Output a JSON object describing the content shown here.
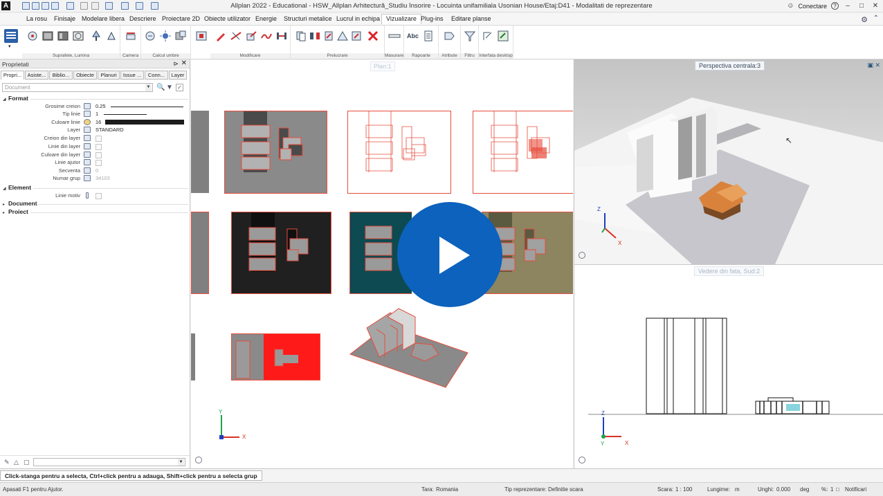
{
  "window": {
    "title": "Allplan 2022 - Educational - HSW_Allplan Arhitectură_Studiu însorire - Locuinta unifamiliala Usonian House/Etaj:D41 - Modalitati de reprezentare",
    "connect_label": "Conectare",
    "help_symbol": "?"
  },
  "menu": {
    "tabs": [
      "La rosu",
      "Finisaje",
      "Modelare libera",
      "Descriere",
      "Proiectare 2D",
      "Obiecte utilizator",
      "Energie",
      "Structuri metalice",
      "Lucrul in echipa",
      "Vizualizare",
      "Plug-ins",
      "Editare planse"
    ],
    "active": "Vizualizare"
  },
  "ribbon": {
    "groups": [
      "Suprafete, Lumina",
      "Camera",
      "Calcul umbre",
      "Modificare",
      "Prelucrare",
      "Masurare",
      "Rapoarte",
      "Atribute",
      "Filtru",
      "Interfata desktop"
    ],
    "icons": [
      "properties-icon",
      "surface-icon",
      "render-icon",
      "material-icon",
      "light-icon",
      "sun-icon",
      "camera-icon",
      "camera-path-icon",
      "shadow-icon",
      "sun-study-icon",
      "shadow-calc-icon",
      "edit-icon",
      "trim-icon",
      "move-icon",
      "stretch-icon",
      "split-icon",
      "copy-icon",
      "mirror-icon",
      "rotate-icon",
      "scale-icon",
      "measure-icon",
      "delete-icon",
      "dimension-icon",
      "text-icon",
      "report-icon",
      "attribute-icon",
      "filter-icon",
      "desktop-icon",
      "window-icon"
    ],
    "text_icon_label": "Abc"
  },
  "palette": {
    "title": "Proprietati",
    "tabs": [
      "Propri...",
      "Asiste...",
      "Biblio...",
      "Obiecte",
      "Planuri",
      "Issue ...",
      "Conn...",
      "Layer"
    ],
    "active_tab": "Propri...",
    "selector_placeholder": "Document",
    "sections": {
      "format": "Format",
      "element": "Element",
      "document": "Document",
      "project": "Proiect"
    },
    "properties": [
      {
        "label": "Grosime creion",
        "value": "0.25",
        "kind": "line",
        "icon": "pen-icon"
      },
      {
        "label": "Tip linie",
        "value": "1",
        "kind": "line",
        "icon": "linetype-icon"
      },
      {
        "label": "Culoare linie",
        "value": "16",
        "kind": "color",
        "icon": "color-icon"
      },
      {
        "label": "Layer",
        "value": "STANDARD",
        "kind": "text",
        "icon": "layer-icon"
      },
      {
        "label": "Creion din layer",
        "value": "",
        "kind": "check",
        "icon": "pen-layer-icon"
      },
      {
        "label": "Linie din layer",
        "value": "",
        "kind": "check",
        "icon": "line-layer-icon"
      },
      {
        "label": "Culoare din layer",
        "value": "",
        "kind": "check",
        "icon": "color-layer-icon"
      },
      {
        "label": "Linie ajutor",
        "value": "",
        "kind": "check",
        "icon": "helpline-icon"
      },
      {
        "label": "Secventa",
        "value": "0",
        "kind": "dim",
        "icon": "sequence-icon"
      },
      {
        "label": "Numar grup",
        "value": "34103",
        "kind": "dim",
        "icon": "group-icon"
      }
    ],
    "element_props": [
      {
        "label": "Linie motiv",
        "value": "",
        "kind": "check",
        "icon": "pattern-line-icon"
      }
    ]
  },
  "viewports": {
    "main_label": "Plan:1",
    "perspective_label": "Perspectiva centrala:3",
    "front_label": "Vedere din fata, Sud:2",
    "axis_x": "X",
    "axis_y": "Y",
    "axis_z": "Z"
  },
  "status": {
    "prompt": "Click-stanga pentru a selecta, Ctrl+click pentru a adauga, Shift+click pentru a selecta grup",
    "help": "Apasati F1 pentru Ajutor.",
    "country_label": "Tara:",
    "country": "Romania",
    "repr_label": "Tip reprezentare:",
    "repr": "Definitie scara",
    "scale_label": "Scara:",
    "scale": "1 : 100",
    "length_label": "Lungime:",
    "length": "m",
    "angle_label": "Unghi:",
    "angle": "0.000",
    "angle_unit": "deg",
    "percent_label": "%:",
    "percent": "1",
    "notify": "Notificari"
  },
  "colors": {
    "accent": "#0c62bd",
    "outline_red": "#e74c3c",
    "axis_green": "#1aa34a",
    "axis_red": "#d93025",
    "axis_blue": "#1f3fbf",
    "roof_orange": "#d9823b"
  }
}
